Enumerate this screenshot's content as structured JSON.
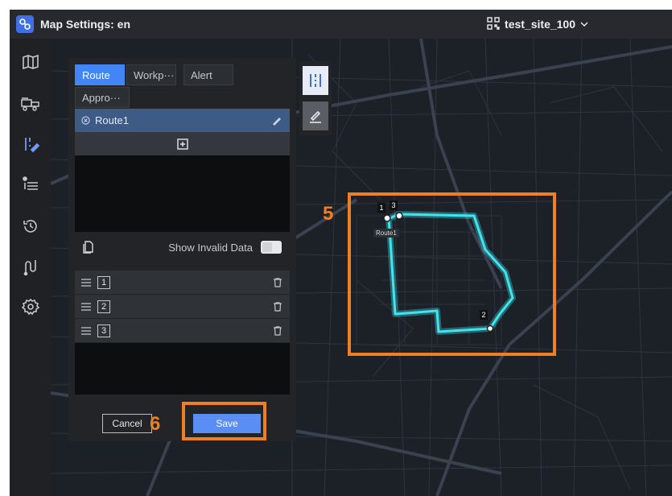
{
  "window": {
    "title": "Map Settings: en",
    "site": "test_site_100"
  },
  "sidebar": {
    "items": [
      {
        "icon": "map-icon"
      },
      {
        "icon": "vehicle-icon"
      },
      {
        "icon": "route-edit-icon"
      },
      {
        "icon": "list-icon"
      },
      {
        "icon": "history-icon"
      },
      {
        "icon": "path-icon"
      },
      {
        "icon": "gear-icon"
      }
    ]
  },
  "tabs": [
    {
      "label": "Route",
      "active": true
    },
    {
      "label": "Workp···",
      "active": false
    },
    {
      "label": "Alert",
      "active": false
    },
    {
      "label": "Appro···",
      "active": false
    }
  ],
  "route": {
    "name": "Route1"
  },
  "show_invalid": {
    "label": "Show Invalid Data",
    "on": true
  },
  "waypoints": [
    {
      "num": "1"
    },
    {
      "num": "2"
    },
    {
      "num": "3"
    }
  ],
  "buttons": {
    "cancel": "Cancel",
    "save": "Save"
  },
  "map": {
    "labels": {
      "wp1": "1",
      "wp3": "3",
      "wp2": "2",
      "route": "Route1"
    }
  },
  "annotations": {
    "step5": "5",
    "step6": "6"
  },
  "colors": {
    "accent": "#4285f4",
    "route": "#3fe4ee",
    "highlight": "#ef7f22"
  }
}
